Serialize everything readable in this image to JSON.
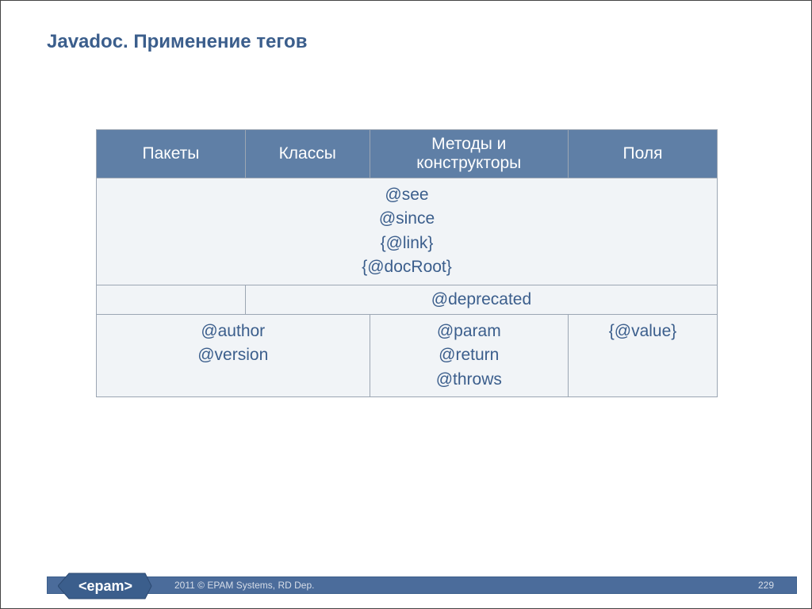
{
  "title": "Javadoc. Применение тегов",
  "table": {
    "headers": [
      "Пакеты",
      "Классы",
      "Методы и конструкторы",
      "Поля"
    ],
    "row_all": [
      "@see",
      "@since",
      "{@link}",
      "{@docRoot}"
    ],
    "row_deprecated": {
      "col1": "",
      "rest": "@deprecated"
    },
    "row_bottom": {
      "pkg_cls": [
        "@author",
        "@version"
      ],
      "methods": [
        "@param",
        "@return",
        "@throws"
      ],
      "fields": [
        "{@value}"
      ]
    }
  },
  "footer": {
    "logo_text": "<epam>",
    "copyright": "2011 © EPAM Systems, RD Dep.",
    "page": "229"
  }
}
